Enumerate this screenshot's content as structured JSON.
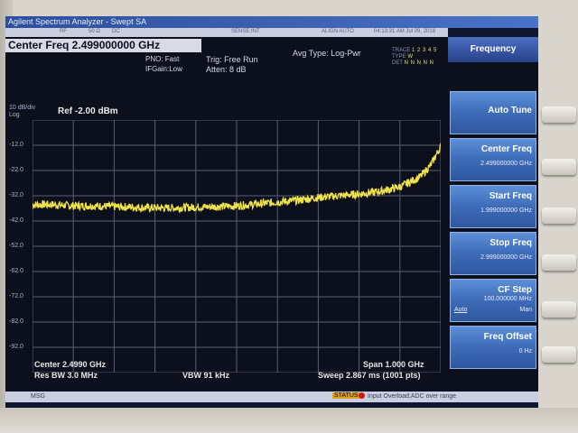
{
  "window": {
    "title": "Agilent Spectrum Analyzer - Swept SA"
  },
  "settings_bar": {
    "rf": "RF",
    "impedance": "50 Ω",
    "coupling": "DC",
    "sense": "SENSE:INT",
    "align": "ALIGN AUTO",
    "clock": "04:13:31 AM Jul 09, 2018"
  },
  "header": {
    "center_freq": "Center Freq 2.499000000 GHz",
    "pno": "PNO: Fast",
    "ifgain": "IFGain:Low",
    "trig": "Trig: Free Run",
    "atten": "Atten: 8 dB",
    "avg_type": "Avg Type: Log-Pwr",
    "trace_label": "TRACE",
    "trace_nums": "1 2 3 4 5",
    "type_label": "TYPE",
    "type_vals": "W",
    "det_label": "DET",
    "det_vals": "N N N N N"
  },
  "plot": {
    "scale": "10 dB/div",
    "log": "Log",
    "ref_level": "Ref -2.00 dBm",
    "y_ticks": [
      "-12.0",
      "-22.0",
      "-32.0",
      "-42.0",
      "-52.0",
      "-62.0",
      "-72.0",
      "-82.0",
      "-92.0"
    ],
    "trace_color": "#f0e34a",
    "grid_color": "#5a5f73"
  },
  "chart_data": {
    "type": "line",
    "title": "",
    "xlabel": "",
    "ylabel": "",
    "x_range_ghz": [
      1.999,
      2.999
    ],
    "ylim": [
      -102,
      -2
    ],
    "points": 1001,
    "series": [
      {
        "x": [
          1.999,
          2.049,
          2.099,
          2.149,
          2.199,
          2.249,
          2.299,
          2.349,
          2.399,
          2.449,
          2.499,
          2.549,
          2.599,
          2.649,
          2.699,
          2.749,
          2.799,
          2.849,
          2.899,
          2.949,
          2.974,
          2.999
        ],
        "y": [
          -35.5,
          -35.5,
          -36.0,
          -36.0,
          -36.3,
          -36.5,
          -36.8,
          -36.8,
          -36.5,
          -36.3,
          -36.0,
          -35.3,
          -34.5,
          -33.8,
          -32.7,
          -32.0,
          -31.3,
          -30.3,
          -28.5,
          -24.5,
          -20.0,
          -12.5
        ]
      }
    ]
  },
  "footer": {
    "center": "Center 2.4990 GHz",
    "res_bw": "Res BW 3.0 MHz",
    "vbw": "VBW 91 kHz",
    "span": "Span 1.000 GHz",
    "sweep": "Sweep  2.867 ms (1001 pts)"
  },
  "status": {
    "msg": "MSG",
    "label": "STATUS",
    "text": "Input Overload;ADC over range"
  },
  "softkeys": {
    "menu_title": "Frequency",
    "items": [
      {
        "label": "Auto Tune",
        "value": ""
      },
      {
        "label": "Center Freq",
        "value": "2.499000000 GHz"
      },
      {
        "label": "Start Freq",
        "value": "1.999000000 GHz"
      },
      {
        "label": "Stop Freq",
        "value": "2.999000000 GHz"
      },
      {
        "label": "CF Step",
        "value": "100.000000 MHz",
        "auto": "Auto",
        "man": "Man"
      },
      {
        "label": "Freq Offset",
        "value": "0 Hz"
      }
    ]
  }
}
